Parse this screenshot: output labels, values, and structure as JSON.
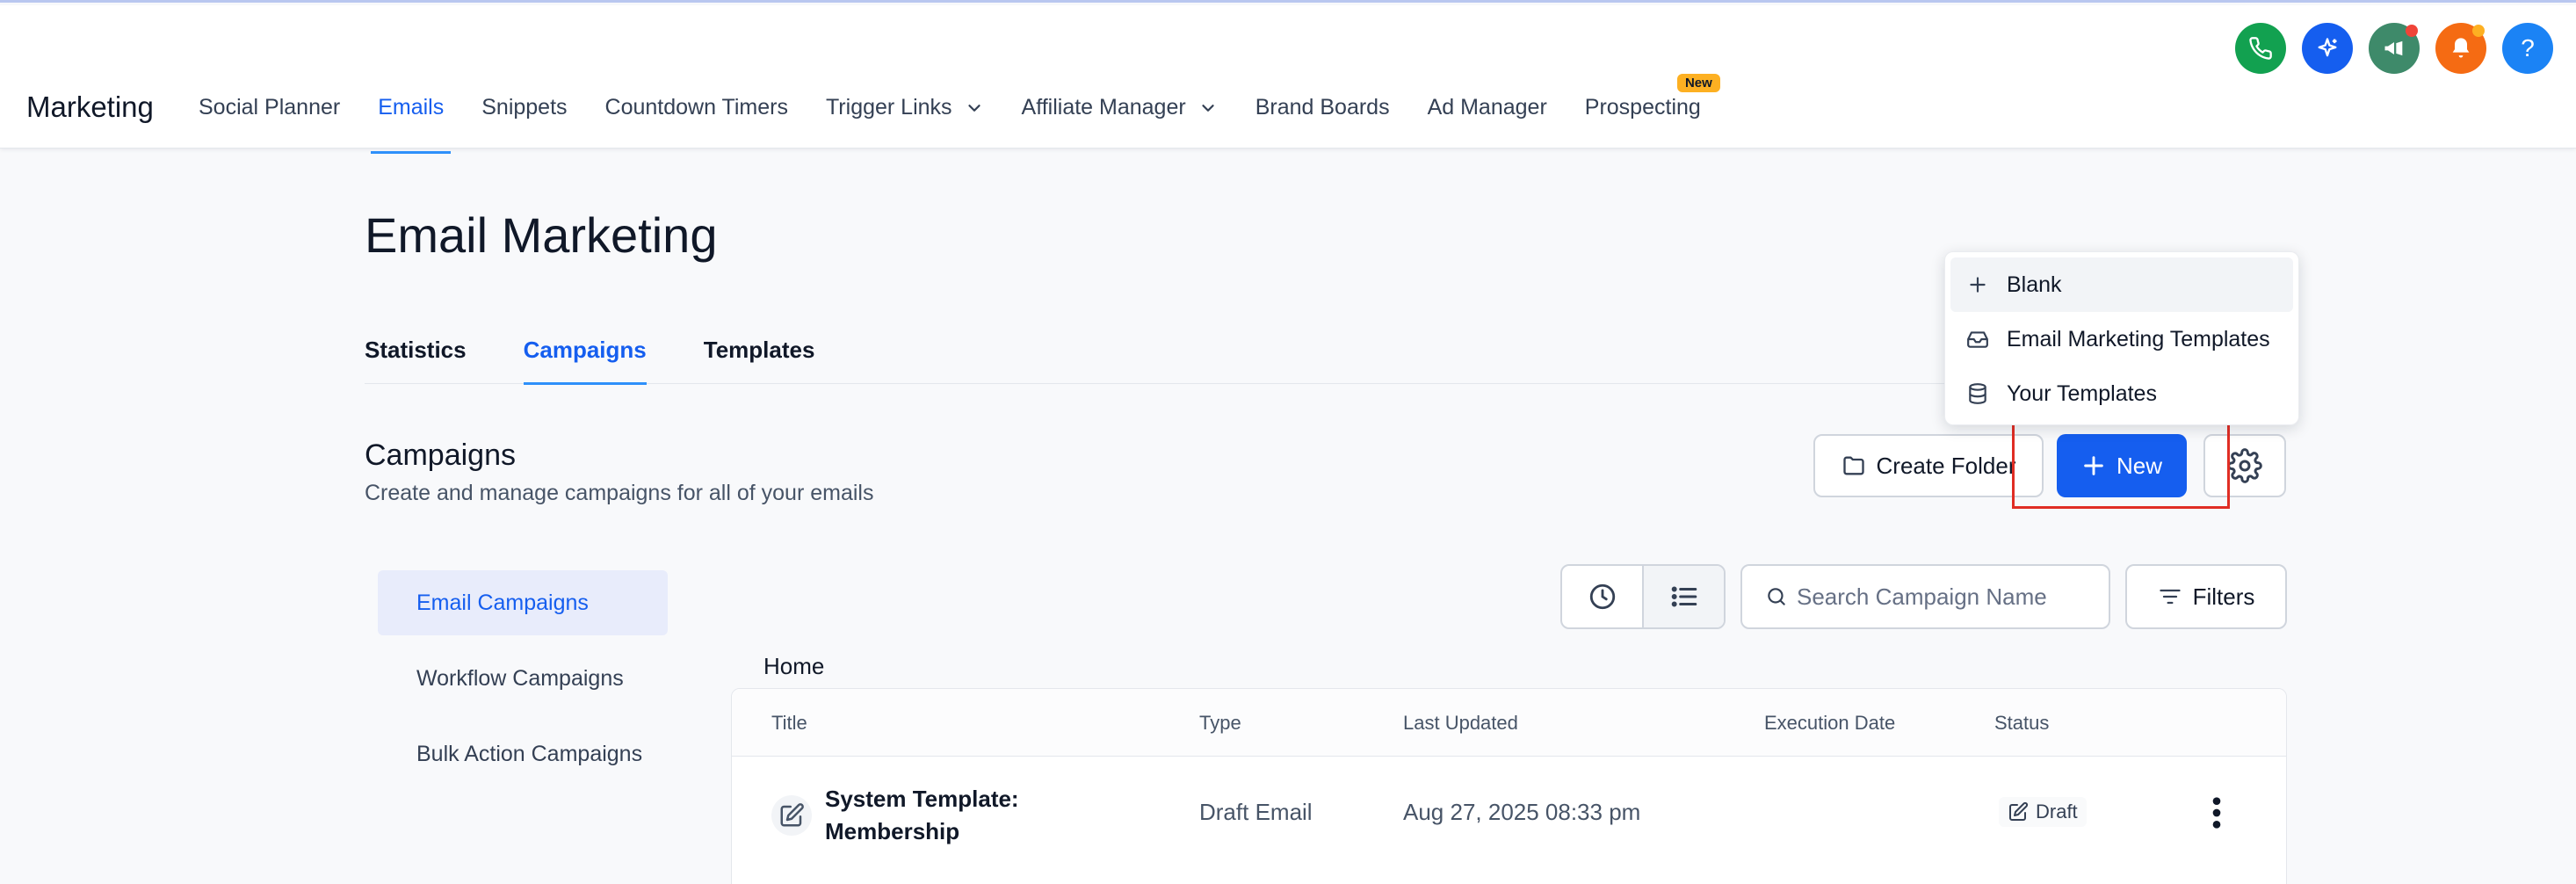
{
  "app": {
    "brand": "Marketing"
  },
  "nav": {
    "items": [
      {
        "label": "Social Planner",
        "active": false
      },
      {
        "label": "Emails",
        "active": true
      },
      {
        "label": "Snippets",
        "active": false
      },
      {
        "label": "Countdown Timers",
        "active": false
      },
      {
        "label": "Trigger Links",
        "active": false,
        "dropdown": true
      },
      {
        "label": "Affiliate Manager",
        "active": false,
        "dropdown": true
      },
      {
        "label": "Brand Boards",
        "active": false
      },
      {
        "label": "Ad Manager",
        "active": false
      },
      {
        "label": "Prospecting",
        "active": false,
        "badge": "New"
      }
    ]
  },
  "top_icons": [
    {
      "name": "phone-icon",
      "color": "#12a150"
    },
    {
      "name": "sparkle-icon",
      "color": "#155eef"
    },
    {
      "name": "megaphone-icon",
      "color": "#3e8a6a",
      "dot": "#f04438"
    },
    {
      "name": "bell-icon",
      "color": "#f56b13",
      "dot": "#fdb022"
    },
    {
      "name": "help-icon",
      "color": "#1b83f5",
      "glyph": "?"
    }
  ],
  "page": {
    "title": "Email Marketing"
  },
  "tabs": [
    {
      "label": "Statistics",
      "active": false
    },
    {
      "label": "Campaigns",
      "active": true
    },
    {
      "label": "Templates",
      "active": false
    }
  ],
  "section": {
    "title": "Campaigns",
    "subtitle": "Create and manage campaigns for all of your emails"
  },
  "actions": {
    "create_folder": "Create Folder",
    "new": "New"
  },
  "new_menu": {
    "items": [
      {
        "label": "Blank",
        "icon": "plus-icon"
      },
      {
        "label": "Email Marketing Templates",
        "icon": "inbox-icon"
      },
      {
        "label": "Your Templates",
        "icon": "database-icon"
      }
    ]
  },
  "sidebar": {
    "items": [
      {
        "label": "Email Campaigns",
        "active": true
      },
      {
        "label": "Workflow Campaigns",
        "active": false
      },
      {
        "label": "Bulk Action Campaigns",
        "active": false
      }
    ]
  },
  "toolbar": {
    "search_placeholder": "Search Campaign Name",
    "filters": "Filters"
  },
  "breadcrumb": "Home",
  "table": {
    "columns": [
      "Title",
      "Type",
      "Last Updated",
      "Execution Date",
      "Status"
    ],
    "rows": [
      {
        "title": "System Template: Membership",
        "type": "Draft Email",
        "last_updated": "Aug 27, 2025 08:33 pm",
        "execution_date": "",
        "status": "Draft"
      }
    ]
  }
}
